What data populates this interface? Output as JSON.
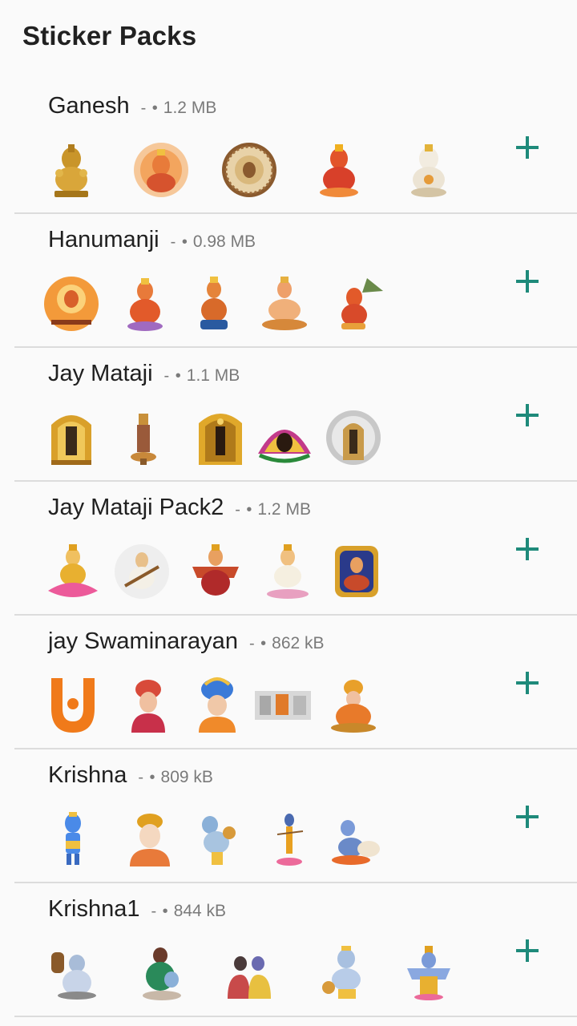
{
  "header": {
    "title": "Sticker Packs"
  },
  "theme": {
    "accent": "#1e8a7a",
    "divider": "#dcdcdc"
  },
  "packs": [
    {
      "name": "Ganesh",
      "separator": "- •",
      "size": "1.2 MB",
      "stickers": [
        "ganesh-gold-idol-icon",
        "ganesh-round-portrait-icon",
        "ganesh-mandala-icon",
        "ganesh-red-idol-icon",
        "ganesh-white-idol-icon"
      ]
    },
    {
      "name": "Hanumanji",
      "separator": "- •",
      "size": "0.98 MB",
      "stickers": [
        "hanuman-round-portrait-icon",
        "hanuman-seated-icon",
        "hanuman-kneeling-icon",
        "hanuman-meditating-icon",
        "hanuman-flying-mountain-icon"
      ]
    },
    {
      "name": "Jay Mataji",
      "separator": "- •",
      "size": "1.1 MB",
      "stickers": [
        "balaji-gold-idol-icon",
        "deity-standing-lamp-icon",
        "balaji-temple-frame-icon",
        "goddess-garland-icon",
        "balaji-silver-round-icon"
      ]
    },
    {
      "name": "Jay Mataji Pack2",
      "separator": "- •",
      "size": "1.2 MB",
      "stickers": [
        "lakshmi-lotus-icon",
        "saraswati-veena-round-icon",
        "durga-multi-arm-icon",
        "saraswati-swan-icon",
        "durga-lion-icon"
      ]
    },
    {
      "name": "jay Swaminarayan",
      "separator": "- •",
      "size": "862 kB",
      "stickers": [
        "swaminarayan-orange-logo-icon",
        "swaminarayan-turban-portrait-icon",
        "swaminarayan-blue-turban-icon",
        "temple-scene-icon",
        "swaminarayan-seated-icon"
      ]
    },
    {
      "name": "Krishna",
      "separator": "- •",
      "size": "809 kB",
      "stickers": [
        "krishna-blue-cartoon-icon",
        "krishna-portrait-icon",
        "krishna-child-pot-icon",
        "krishna-flute-standing-icon",
        "krishna-cow-icon"
      ]
    },
    {
      "name": "Krishna1",
      "separator": "- •",
      "size": "844 kB",
      "stickers": [
        "krishna-butter-churn-icon",
        "yashoda-krishna-icon",
        "radha-krishna-icon",
        "krishna-butter-eating-icon",
        "vishnu-multi-arm-icon"
      ]
    }
  ]
}
